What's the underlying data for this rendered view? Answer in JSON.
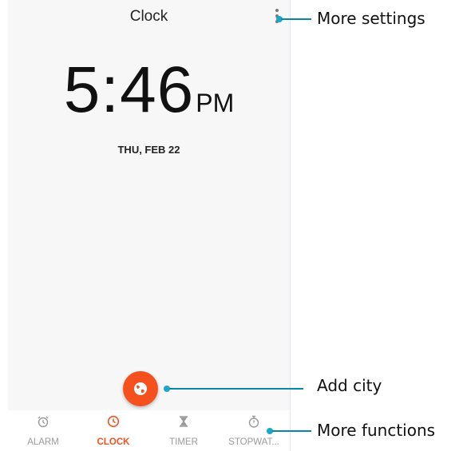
{
  "app": {
    "title": "Clock"
  },
  "clock": {
    "time": "5:46",
    "ampm": "PM",
    "date": "THU, FEB 22"
  },
  "tabs": [
    {
      "label": "ALARM",
      "icon": "alarm-icon",
      "active": false
    },
    {
      "label": "CLOCK",
      "icon": "clock-icon",
      "active": true
    },
    {
      "label": "TIMER",
      "icon": "hourglass-icon",
      "active": false
    },
    {
      "label": "STOPWAT...",
      "icon": "stopwatch-icon",
      "active": false
    }
  ],
  "fab": {
    "icon": "globe-icon"
  },
  "annotations": {
    "more_settings": "More settings",
    "add_city": "Add city",
    "more_functions": "More functions"
  },
  "colors": {
    "accent": "#f4511e",
    "callout": "#0a85a8",
    "inactive": "#9a9a9a"
  }
}
